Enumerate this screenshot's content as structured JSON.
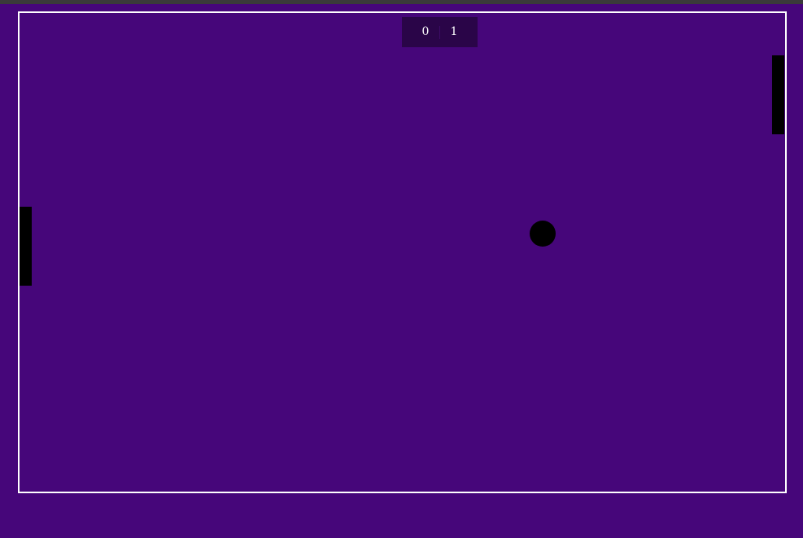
{
  "game": {
    "background_color": "#46067a",
    "court_border_color": "#ffffff",
    "scoreboard": {
      "background_color": "#2a0548",
      "text_color": "#ffffff",
      "left_score": "0",
      "right_score": "1"
    },
    "paddle_color": "#000000",
    "ball_color": "#000000"
  }
}
